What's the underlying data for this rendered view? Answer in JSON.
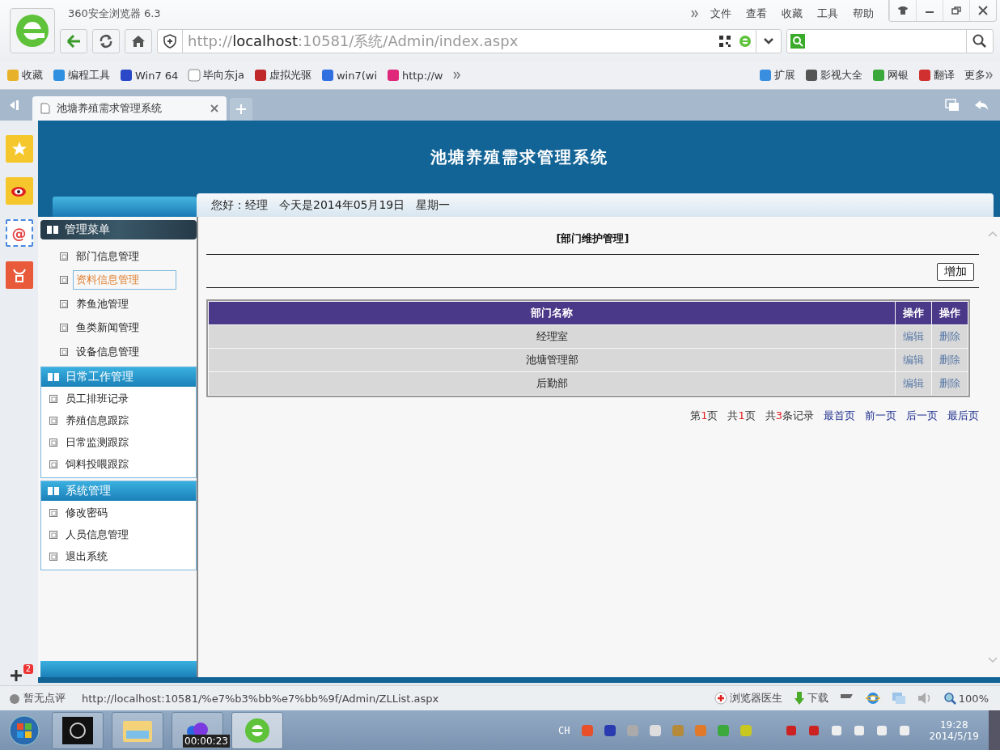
{
  "browser": {
    "title": "360安全浏览器 6.3",
    "menu": [
      "文件",
      "查看",
      "收藏",
      "工具",
      "帮助"
    ],
    "address": {
      "prefix": "http://",
      "host": "localhost",
      "rest": ":10581/系统/Admin/index.aspx"
    },
    "bookmarks": [
      {
        "label": "收藏",
        "kind": "star"
      },
      {
        "label": "编程工具",
        "kind": "cloud"
      },
      {
        "label": "Win7 64",
        "kind": "paw"
      },
      {
        "label": "毕向东ja",
        "kind": "page"
      },
      {
        "label": "虚拟光驱",
        "kind": "hourglass"
      },
      {
        "label": "win7(wi",
        "kind": "circle"
      },
      {
        "label": "http://w",
        "kind": "heart"
      }
    ],
    "right_bookmarks": [
      {
        "label": "扩展",
        "kind": "blocks"
      },
      {
        "label": "影视大全",
        "kind": "film"
      },
      {
        "label": "网银",
        "kind": "shield"
      },
      {
        "label": "翻译",
        "kind": "book"
      },
      {
        "label": "更多",
        "kind": "more"
      }
    ],
    "tabs": [
      {
        "label": "池塘养殖需求管理系统",
        "selected": true
      }
    ]
  },
  "page": {
    "title": "池塘养殖需求管理系统",
    "welcome": "您好：经理　今天是2014年05月19日　星期一",
    "menu_sections": [
      {
        "title": "管理菜单",
        "kind": "dark",
        "items": [
          {
            "label": "部门信息管理",
            "selected": false
          },
          {
            "label": "资料信息管理",
            "selected": true
          },
          {
            "label": "养鱼池管理",
            "selected": false
          },
          {
            "label": "鱼类新闻管理",
            "selected": false
          },
          {
            "label": "设备信息管理",
            "selected": false
          }
        ]
      },
      {
        "title": "日常工作管理",
        "kind": "blue",
        "items": [
          {
            "label": "员工排班记录",
            "selected": false
          },
          {
            "label": "养殖信息跟踪",
            "selected": false
          },
          {
            "label": "日常监测跟踪",
            "selected": false
          },
          {
            "label": "饲料投喂跟踪",
            "selected": false
          }
        ]
      },
      {
        "title": "系统管理",
        "kind": "blue",
        "items": [
          {
            "label": "修改密码",
            "selected": false
          },
          {
            "label": "人员信息管理",
            "selected": false
          },
          {
            "label": "退出系统",
            "selected": false
          }
        ]
      }
    ],
    "section_title": "[部门维护管理]",
    "add_button": "增加",
    "table": {
      "columns": [
        "部门名称",
        "操作",
        "操作"
      ],
      "rows": [
        {
          "name": "经理室",
          "edit": "编辑",
          "delete": "删除"
        },
        {
          "name": "池塘管理部",
          "edit": "编辑",
          "delete": "删除"
        },
        {
          "name": "后勤部",
          "edit": "编辑",
          "delete": "删除"
        }
      ]
    },
    "pager": {
      "counts": [
        {
          "before": "第",
          "num": "1",
          "after": "页"
        },
        {
          "before": "共",
          "num": "1",
          "after": "页"
        },
        {
          "before": "共",
          "num": "3",
          "after": "条记录"
        }
      ],
      "links": [
        "最首页",
        "前一页",
        "后一页",
        "最后页"
      ]
    }
  },
  "status_bar": {
    "rating": "暂无点评",
    "url": "http://localhost:10581/%e7%b3%bb%e7%bb%9f/Admin/ZLList.aspx",
    "doctor": "浏览器医生",
    "download": "下载",
    "zoom": "100%"
  },
  "side_badge": "2",
  "mail_glyph": "@",
  "taskbar": {
    "tooltip": "00:00:23",
    "lang": "CH",
    "time": "19:28",
    "date": "2014/5/19"
  }
}
